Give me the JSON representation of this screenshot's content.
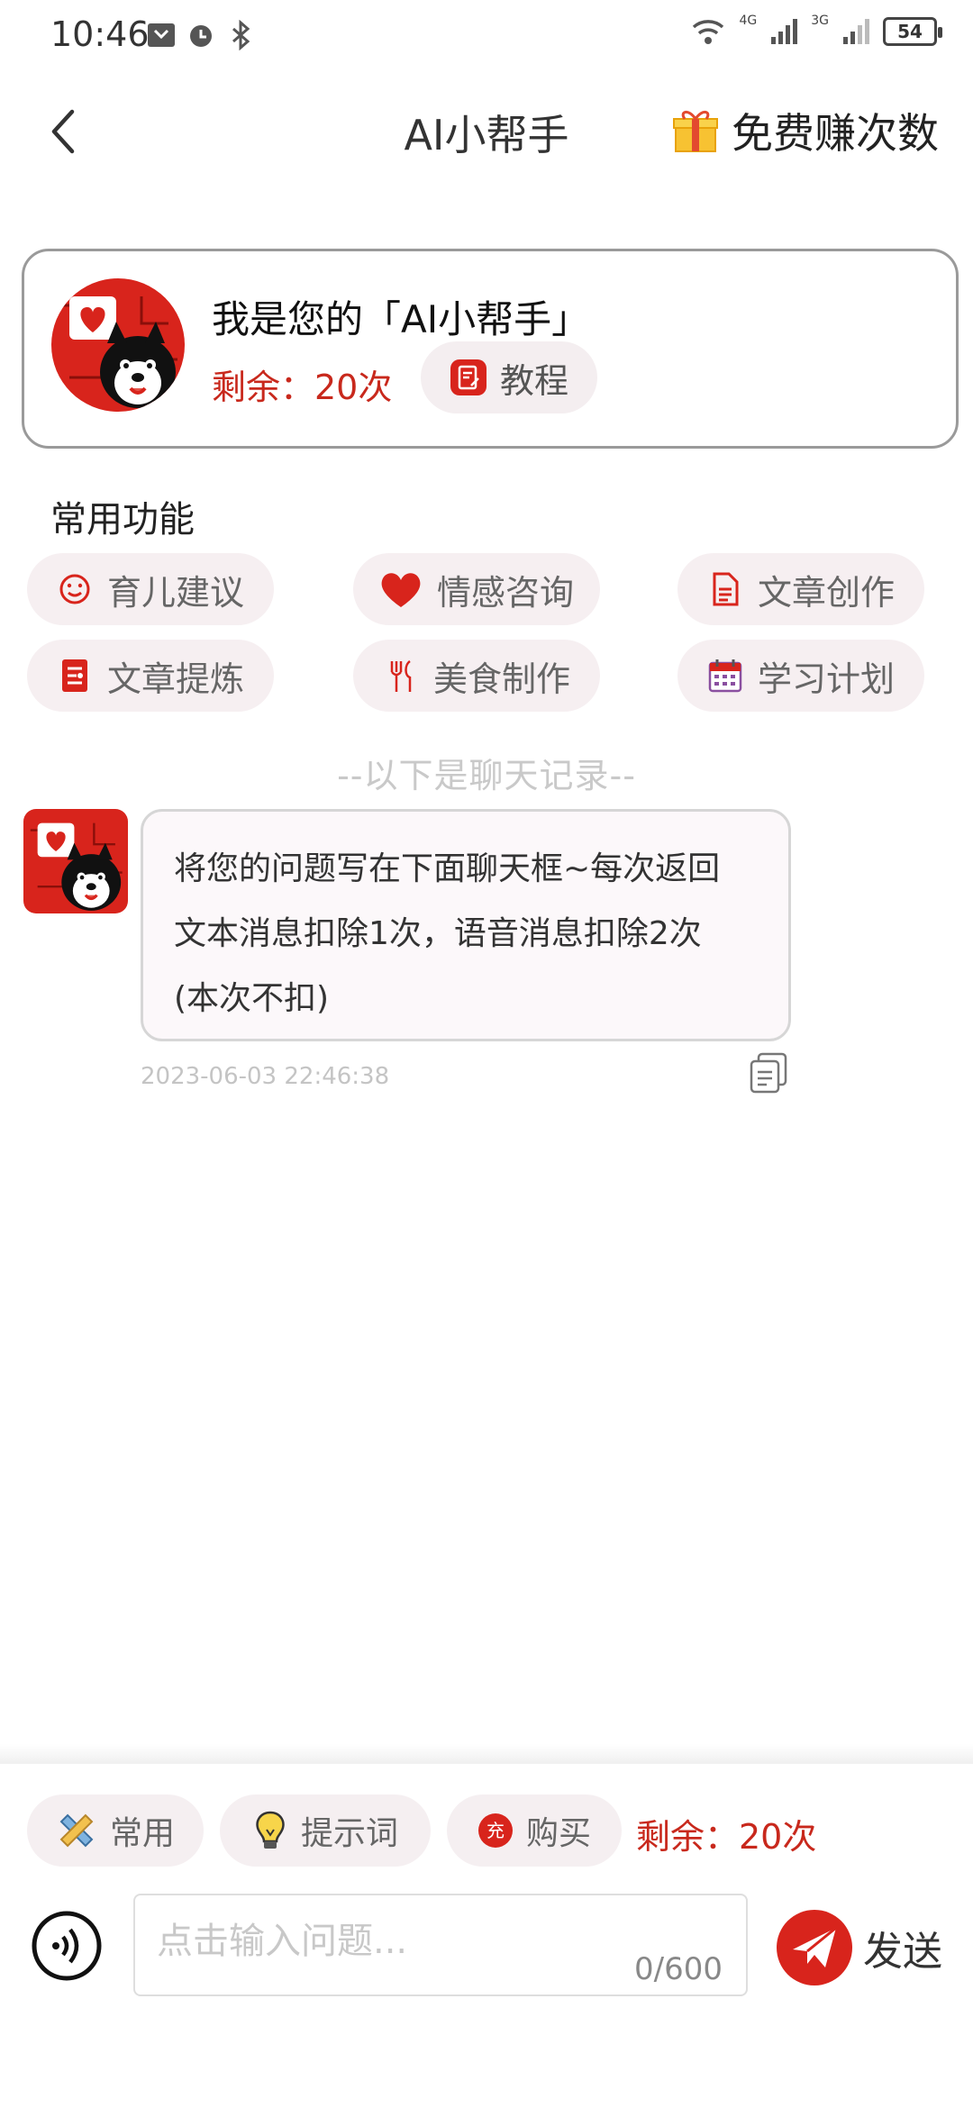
{
  "status_bar": {
    "time": "10:46",
    "net1": "4G",
    "net2": "3G",
    "battery": "54"
  },
  "header": {
    "title": "AI小帮手",
    "earn_label": "免费赚次数"
  },
  "profile": {
    "name": "我是您的「AI小帮手」",
    "remaining": "剩余：20次",
    "tutorial_label": "教程"
  },
  "functions": {
    "title": "常用功能",
    "items": [
      {
        "label": "育儿建议",
        "icon": "smile-icon"
      },
      {
        "label": "情感咨询",
        "icon": "heart-icon"
      },
      {
        "label": "文章创作",
        "icon": "document-icon"
      },
      {
        "label": "文章提炼",
        "icon": "list-doc-icon"
      },
      {
        "label": "美食制作",
        "icon": "fork-icon"
      },
      {
        "label": "学习计划",
        "icon": "calendar-icon"
      }
    ]
  },
  "chat": {
    "divider": "--以下是聊天记录--",
    "messages": [
      {
        "lines": [
          "将您的问题写在下面聊天框~每次返回",
          "文本消息扣除1次，语音消息扣除2次",
          "(本次不扣)"
        ],
        "time": "2023-06-03 22:46:38"
      }
    ]
  },
  "bottom": {
    "tools": [
      {
        "label": "常用",
        "icon": "pencil-ruler-icon"
      },
      {
        "label": "提示词",
        "icon": "lightbulb-icon"
      },
      {
        "label": "购买",
        "icon": "charge-icon",
        "icon_text": "充"
      }
    ],
    "remaining": "剩余：20次",
    "input_placeholder": "点击输入问题...",
    "counter": "0/600",
    "send_label": "发送"
  },
  "colors": {
    "accent": "#c8281c",
    "pill_bg": "#f6eff1"
  }
}
